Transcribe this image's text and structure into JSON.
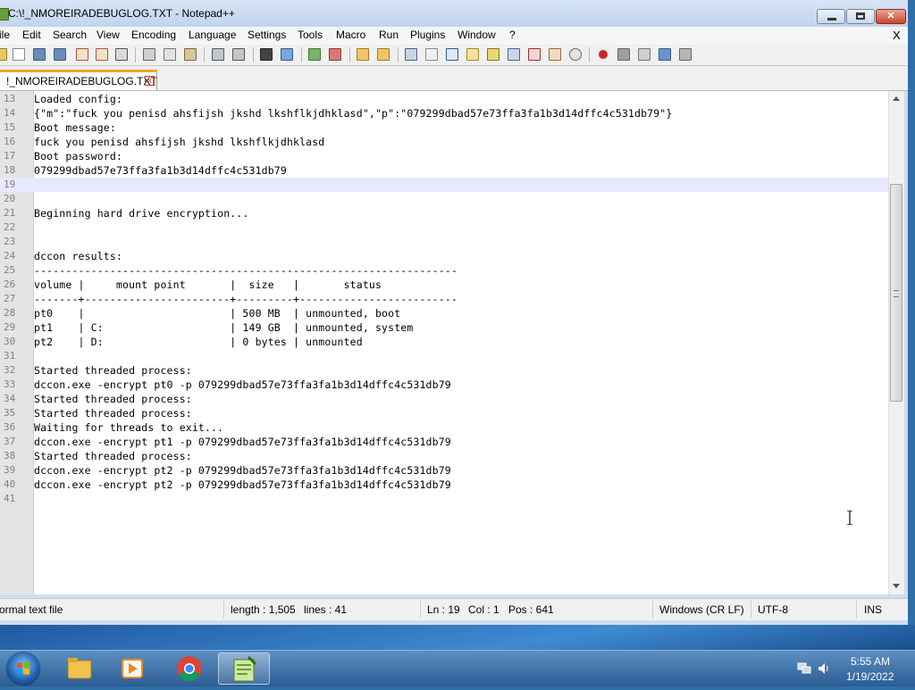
{
  "window": {
    "title": "C:\\!_NMOREIRADEBUGLOG.TXT - Notepad++",
    "min_glyph": "",
    "max_glyph": "",
    "close_glyph": "✕"
  },
  "menu": {
    "items": [
      "ile",
      "Edit",
      "Search",
      "View",
      "Encoding",
      "Language",
      "Settings",
      "Tools",
      "Macro",
      "Run",
      "Plugins",
      "Window",
      "?"
    ],
    "close": "X"
  },
  "tab": {
    "label": "!_NMOREIRADEBUGLOG.TXT",
    "close": "x"
  },
  "editor": {
    "current_line": 19,
    "lines": [
      {
        "n": "13",
        "t": "Loaded config:"
      },
      {
        "n": "14",
        "t": "{\"m\":\"fuck you penisd ahsfijsh jkshd lkshflkjdhklasd\",\"p\":\"079299dbad57e73ffa3fa1b3d14dffc4c531db79\"}"
      },
      {
        "n": "15",
        "t": "Boot message:"
      },
      {
        "n": "16",
        "t": "fuck you penisd ahsfijsh jkshd lkshflkjdhklasd"
      },
      {
        "n": "17",
        "t": "Boot password:"
      },
      {
        "n": "18",
        "t": "079299dbad57e73ffa3fa1b3d14dffc4c531db79"
      },
      {
        "n": "19",
        "t": ""
      },
      {
        "n": "20",
        "t": ""
      },
      {
        "n": "21",
        "t": "Beginning hard drive encryption..."
      },
      {
        "n": "22",
        "t": ""
      },
      {
        "n": "23",
        "t": ""
      },
      {
        "n": "24",
        "t": "dccon results:"
      },
      {
        "n": "25",
        "t": "-------------------------------------------------------------------"
      },
      {
        "n": "26",
        "t": "volume |     mount point       |  size   |       status"
      },
      {
        "n": "27",
        "t": "-------+-----------------------+---------+-------------------------"
      },
      {
        "n": "28",
        "t": "pt0    |                       | 500 MB  | unmounted, boot"
      },
      {
        "n": "29",
        "t": "pt1    | C:                    | 149 GB  | unmounted, system"
      },
      {
        "n": "30",
        "t": "pt2    | D:                    | 0 bytes | unmounted"
      },
      {
        "n": "31",
        "t": ""
      },
      {
        "n": "32",
        "t": "Started threaded process:"
      },
      {
        "n": "33",
        "t": "dccon.exe -encrypt pt0 -p 079299dbad57e73ffa3fa1b3d14dffc4c531db79"
      },
      {
        "n": "34",
        "t": "Started threaded process:"
      },
      {
        "n": "35",
        "t": "Started threaded process:"
      },
      {
        "n": "36",
        "t": "Waiting for threads to exit..."
      },
      {
        "n": "37",
        "t": "dccon.exe -encrypt pt1 -p 079299dbad57e73ffa3fa1b3d14dffc4c531db79"
      },
      {
        "n": "38",
        "t": "Started threaded process:"
      },
      {
        "n": "39",
        "t": "dccon.exe -encrypt pt2 -p 079299dbad57e73ffa3fa1b3d14dffc4c531db79"
      },
      {
        "n": "40",
        "t": "dccon.exe -encrypt pt2 -p 079299dbad57e73ffa3fa1b3d14dffc4c531db79"
      },
      {
        "n": "41",
        "t": ""
      }
    ]
  },
  "status": {
    "file_type": "ormal text file",
    "length": "length : 1,505",
    "lines": "lines : 41",
    "ln": "Ln : 19",
    "col": "Col : 1",
    "pos": "Pos : 641",
    "eol": "Windows (CR LF)",
    "encoding": "UTF-8",
    "mode": "INS"
  },
  "taskbar": {
    "time": "5:55 AM",
    "date": "1/19/2022",
    "apps": [
      "windows-explorer-icon",
      "media-player-icon",
      "chrome-icon",
      "notepad-plus-plus-icon"
    ]
  },
  "colors": {
    "current_line": "#e8e8ff",
    "tab_accent": "#f5a623",
    "taskbar": "#2b5d93"
  }
}
